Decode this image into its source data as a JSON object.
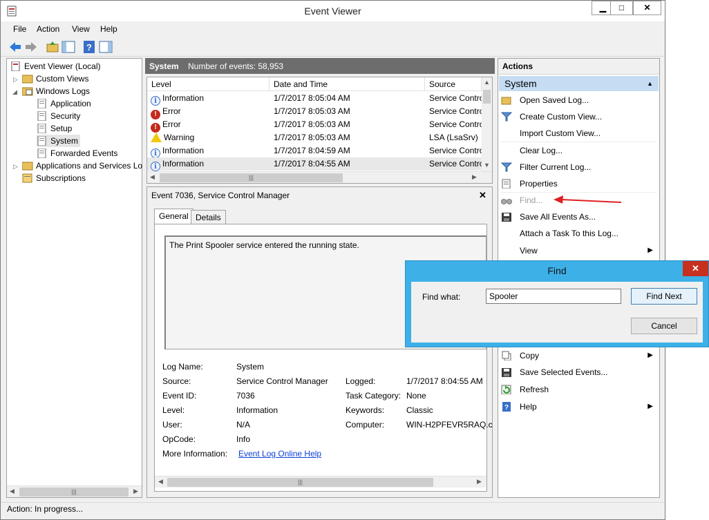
{
  "window": {
    "title": "Event Viewer",
    "minimize": "▁",
    "maximize": "□",
    "close": "✕"
  },
  "menu": [
    "File",
    "Action",
    "View",
    "Help"
  ],
  "tree": {
    "root": "Event Viewer (Local)",
    "custom_views": "Custom Views",
    "windows_logs": "Windows Logs",
    "application": "Application",
    "security": "Security",
    "setup": "Setup",
    "system": "System",
    "forwarded": "Forwarded Events",
    "apps_services": "Applications and Services Lo",
    "subscriptions": "Subscriptions"
  },
  "center": {
    "log_name": "System",
    "count_label": "Number of events: 58,953",
    "columns": [
      "Level",
      "Date and Time",
      "Source"
    ],
    "rows": [
      {
        "level": "Information",
        "type": "info",
        "date": "1/7/2017 8:05:04 AM",
        "source": "Service Contro"
      },
      {
        "level": "Error",
        "type": "error",
        "date": "1/7/2017 8:05:03 AM",
        "source": "Service Contro"
      },
      {
        "level": "Error",
        "type": "error",
        "date": "1/7/2017 8:05:03 AM",
        "source": "Service Contro"
      },
      {
        "level": "Warning",
        "type": "warning",
        "date": "1/7/2017 8:05:03 AM",
        "source": "LSA (LsaSrv)"
      },
      {
        "level": "Information",
        "type": "info",
        "date": "1/7/2017 8:04:59 AM",
        "source": "Service Contro"
      },
      {
        "level": "Information",
        "type": "info",
        "date": "1/7/2017 8:04:55 AM",
        "source": "Service Contro"
      }
    ]
  },
  "detail": {
    "title": "Event 7036, Service Control Manager",
    "close": "✕",
    "tab_general": "General",
    "tab_details": "Details",
    "description": "The Print Spooler service entered the running state.",
    "log_name_l": "Log Name:",
    "log_name_v": "System",
    "source_l": "Source:",
    "source_v": "Service Control Manager",
    "logged_l": "Logged:",
    "logged_v": "1/7/2017 8:04:55 AM",
    "event_id_l": "Event ID:",
    "event_id_v": "7036",
    "task_cat_l": "Task Category:",
    "task_cat_v": "None",
    "level_l": "Level:",
    "level_v": "Information",
    "keywords_l": "Keywords:",
    "keywords_v": "Classic",
    "user_l": "User:",
    "user_v": "N/A",
    "computer_l": "Computer:",
    "computer_v": "WIN-H2PFEVR5RAQ.c",
    "opcode_l": "OpCode:",
    "opcode_v": "Info",
    "more_info_l": "More Information:",
    "more_info_link": "Event Log Online Help"
  },
  "actions": {
    "header": "Actions",
    "section": "System",
    "items": [
      {
        "label": "Open Saved Log...",
        "icon": "folder-open-icon"
      },
      {
        "label": "Create Custom View...",
        "icon": "filter-icon"
      },
      {
        "label": "Import Custom View...",
        "icon": ""
      },
      {
        "label": "Clear Log...",
        "icon": ""
      },
      {
        "label": "Filter Current Log...",
        "icon": "filter-icon"
      },
      {
        "label": "Properties",
        "icon": "properties-icon"
      },
      {
        "label": "Find...",
        "icon": "binoculars-icon"
      },
      {
        "label": "Save All Events As...",
        "icon": "save-icon"
      },
      {
        "label": "Attach a Task To this Log...",
        "icon": ""
      },
      {
        "label": "View",
        "icon": ""
      },
      {
        "label": "Copy",
        "icon": "copy-icon"
      },
      {
        "label": "Save Selected Events...",
        "icon": "save-icon"
      },
      {
        "label": "Refresh",
        "icon": "refresh-icon"
      },
      {
        "label": "Help",
        "icon": "help-icon"
      }
    ]
  },
  "status": "Action:  In progress...",
  "find_dialog": {
    "title": "Find",
    "label": "Find what:",
    "value": "Spooler",
    "find_next": "Find Next",
    "cancel": "Cancel",
    "close": "✕"
  },
  "colors": {
    "accent_blue": "#3db0e8",
    "selection": "#c5dcf3",
    "header_gray": "#6d6d6d",
    "close_red": "#c7301e",
    "annotation_arrow": "#e02020"
  }
}
